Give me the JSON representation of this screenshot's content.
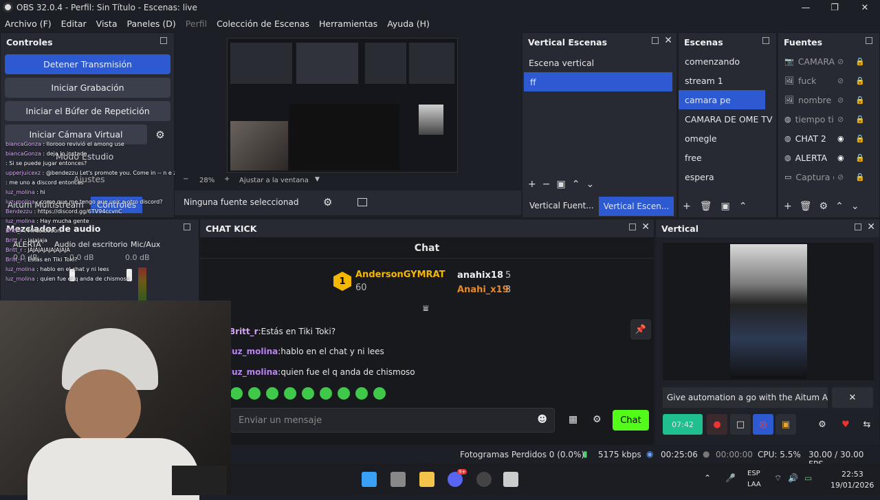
{
  "window": {
    "title": "OBS 32.0.4 - Perfil: Sin Título - Escenas: live",
    "minimize": "—",
    "maximize": "❐",
    "close": "✕"
  },
  "menu": [
    "Archivo (F)",
    "Editar",
    "Vista",
    "Paneles (D)",
    "Perfil",
    "Colección de Escenas",
    "Herramientas",
    "Ayuda (H)"
  ],
  "controls": {
    "title": "Controles",
    "stop_stream": "Detener Transmisión",
    "start_recording": "Iniciar Grabación",
    "start_replay": "Iniciar el Búfer de Repetición",
    "start_virtualcam": "Iniciar Cámara Virtual",
    "studio_mode": "Modo Estudio",
    "settings": "Ajustes",
    "aitum_tab": "Aitum Multistream",
    "controls_tab": "Controles"
  },
  "preview": {
    "zoom": "28%",
    "zoom_minus": "−",
    "zoom_plus": "+",
    "fit": "Ajustar a la ventana",
    "no_source": "Ninguna fuente seleccionad"
  },
  "vertical_scenes": {
    "title": "Vertical Escenas",
    "items": [
      "Escena vertical",
      "ff"
    ],
    "tab_sources": "Vertical Fuent...",
    "tab_scenes": "Vertical Escen..."
  },
  "scenes": {
    "title": "Escenas",
    "items": [
      "comenzando",
      "stream 1",
      "camara pe",
      "CAMARA DE OME TV",
      "omegle",
      "free",
      "espera"
    ]
  },
  "sources": {
    "title": "Fuentes",
    "items": [
      {
        "name": "CAMARA",
        "icon": "camera-icon",
        "visible": false
      },
      {
        "name": "fuck",
        "icon": "image-icon",
        "visible": false
      },
      {
        "name": "nombre",
        "icon": "image-icon",
        "visible": false
      },
      {
        "name": "tiempo ti",
        "icon": "globe-icon",
        "visible": false
      },
      {
        "name": "CHAT 2",
        "icon": "globe-icon",
        "visible": true
      },
      {
        "name": "ALERTA",
        "icon": "globe-icon",
        "visible": true
      },
      {
        "name": "Captura d",
        "icon": "window-icon",
        "visible": false
      }
    ]
  },
  "mixer": {
    "title": "Mezclador de audio",
    "ch1": "ALERTA",
    "ch2": "Audio del escritorio",
    "ch3": "Mic/Aux",
    "db1": "0.0 dB",
    "db2": "0.0 dB",
    "db3": "0.0 dB"
  },
  "overlay_chat": [
    {
      "user": "biancaGonza",
      "msg": "llorooo revivió el among use"
    },
    {
      "user": "biancaGonza",
      "msg": "deja lo instado"
    },
    {
      "user": "",
      "msg": "Si se puede jugar entonces?"
    },
    {
      "user": "upperjuicexz",
      "msg": "@bendezzu Let's promote you. Come in -- n e z h n a . c o m"
    },
    {
      "user": "",
      "msg": "me uno a discord entonces"
    },
    {
      "user": "luz_molina",
      "msg": "hi"
    },
    {
      "user": "luz_molina",
      "msg": "como que me tengo que unir a otro discord?"
    },
    {
      "user": "Bendezzu",
      "msg": "https://discord.gg/6TV94ccvnC"
    },
    {
      "user": "luz_molina",
      "msg": "Hay mucha gente"
    },
    {
      "user": "Britt_r",
      "msg": "Mi coloooorr"
    },
    {
      "user": "Britt_r",
      "msg": "jajajaja"
    },
    {
      "user": "Britt_r",
      "msg": "JAJAJAJAJAJAJAJA"
    },
    {
      "user": "Britt_r",
      "msg": "Estás en Tiki Toki?"
    },
    {
      "user": "luz_molina",
      "msg": "hablo en el chat y ni lees"
    },
    {
      "user": "luz_molina",
      "msg": "quien fue el q anda de chismoso"
    }
  ],
  "chat_kick": {
    "title": "CHAT KICK",
    "header": "Chat",
    "top1": {
      "rank": "1",
      "name": "AndersonGYMRAT",
      "score": "60"
    },
    "top2": {
      "name": "anahix18",
      "score": "5"
    },
    "top3": {
      "name": "Anahi_x19",
      "score": "3"
    },
    "messages": [
      {
        "user": "Britt_r",
        "msg": "Estás en Tiki Toki?"
      },
      {
        "user": "luz_molina",
        "msg": "hablo en el chat y ni lees"
      },
      {
        "user": "luz_molina",
        "msg": "quien fue el q anda de chismoso"
      }
    ],
    "input_placeholder": "Enviar un mensaje",
    "send": "Chat"
  },
  "vertical": {
    "title": "Vertical",
    "banner": "Give automation a go with the Aitum App",
    "timer": "07:42"
  },
  "status": {
    "dropped": "Fotogramas Perdidos 0 (0.0%)",
    "kbps": "5175 kbps",
    "stream_time": "00:25:06",
    "rec_time": "00:00:00",
    "cpu": "CPU: 5.5%",
    "fps": "30.00 / 30.00 FPS"
  },
  "taskbar": {
    "lang1": "ESP",
    "lang2": "LAA",
    "time": "22:53",
    "date": "19/01/2026",
    "badge": "9+"
  },
  "colors": {
    "accent": "#2d5ad1",
    "kick": "#53fc18",
    "panel": "#272a33",
    "bg": "#1d1f26"
  }
}
